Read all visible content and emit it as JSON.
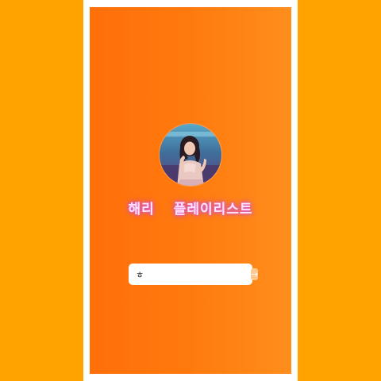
{
  "colors": {
    "background": "#FFA300",
    "frame": "#FFFFFF",
    "screen_gradient_start": "#FF6F0A",
    "screen_gradient_end": "#FF8E1C",
    "title_text": "#FFE3F4",
    "title_glow": "#D457D6",
    "submit_button": "#FFC891"
  },
  "profile": {
    "avatar_icon": "singer-photo"
  },
  "title": {
    "part1": "해리",
    "part2": "플레이리스트"
  },
  "search": {
    "value": "ㅎ",
    "submit_icon": "arrow-right-icon",
    "submit_glyph": "→"
  }
}
